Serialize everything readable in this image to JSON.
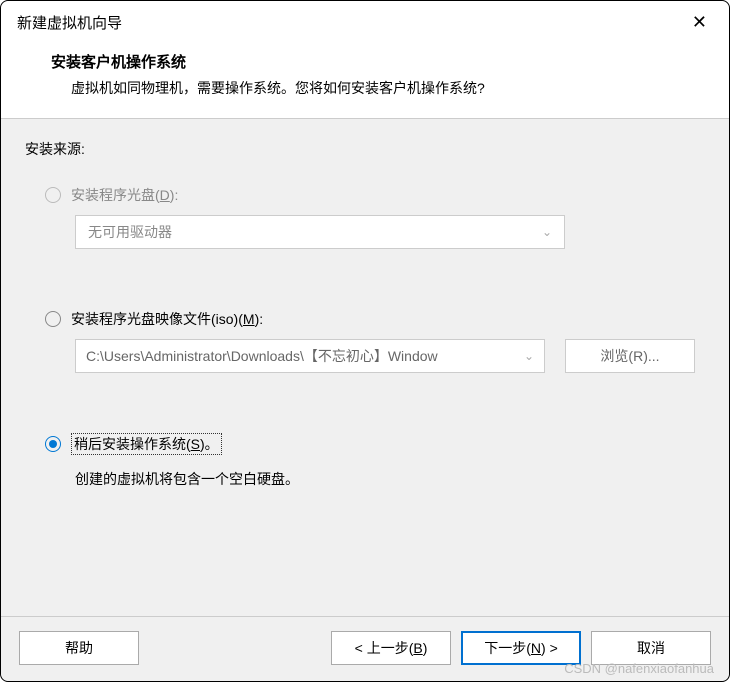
{
  "titlebar": {
    "title": "新建虚拟机向导"
  },
  "header": {
    "title": "安装客户机操作系统",
    "description": "虚拟机如同物理机，需要操作系统。您将如何安装客户机操作系统?"
  },
  "body": {
    "source_label": "安装来源:",
    "option_disc": {
      "label_pre": "安装程序光盘(",
      "accel": "D",
      "label_post": "):",
      "dropdown_value": "无可用驱动器"
    },
    "option_iso": {
      "label_pre": "安装程序光盘映像文件(iso)(",
      "accel": "M",
      "label_post": "):",
      "path_value": "C:\\Users\\Administrator\\Downloads\\【不忘初心】Window",
      "browse_pre": "浏览(",
      "browse_accel": "R",
      "browse_post": ")..."
    },
    "option_later": {
      "label_pre": "稍后安装操作系统(",
      "accel": "S",
      "label_post": ")。",
      "hint": "创建的虚拟机将包含一个空白硬盘。"
    }
  },
  "footer": {
    "help": "帮助",
    "back_pre": "< 上一步(",
    "back_accel": "B",
    "back_post": ")",
    "next_pre": "下一步(",
    "next_accel": "N",
    "next_post": ") >",
    "cancel": "取消"
  },
  "watermark": "CSDN @nafenxiaofanhua"
}
